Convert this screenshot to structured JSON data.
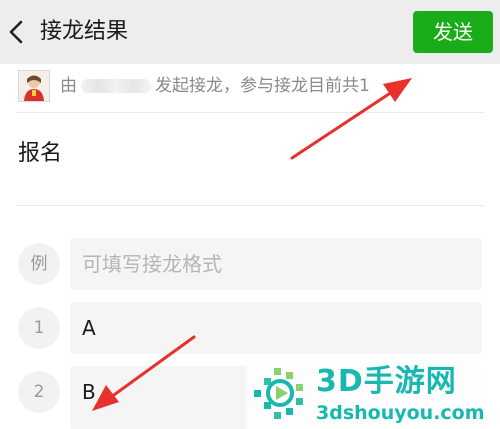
{
  "header": {
    "back_icon": "chevron-left-icon",
    "title": "接龙结果",
    "send_label": "发送",
    "accent_color": "#1aad19"
  },
  "info": {
    "prefix": "由",
    "suffix": "发起接龙，参与接龙目前共1"
  },
  "form": {
    "section_title": "报名",
    "example": {
      "badge": "例",
      "placeholder": "可填写接龙格式"
    },
    "entries": [
      {
        "number": "1",
        "value": "A"
      },
      {
        "number": "2",
        "value": "B"
      }
    ]
  },
  "watermark": {
    "title": "3D手游网",
    "url": "3dshouyou.com",
    "color": "#18b8b0"
  },
  "annotations": {
    "arrow_color": "#e8302c"
  }
}
